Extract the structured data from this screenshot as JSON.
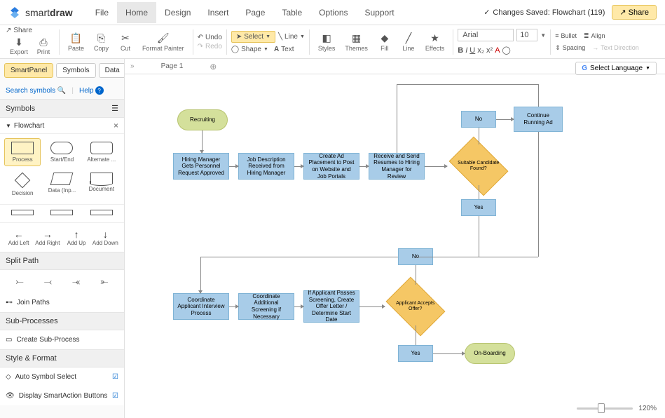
{
  "app": {
    "name_pre": "smart",
    "name_bold": "draw"
  },
  "menu": [
    "File",
    "Home",
    "Design",
    "Insert",
    "Page",
    "Table",
    "Options",
    "Support"
  ],
  "menu_active": 1,
  "status": {
    "saved": "Changes Saved: Flowchart (119)",
    "share": "Share"
  },
  "ribbon": {
    "export": "Export",
    "print": "Print",
    "share": "Share",
    "paste": "Paste",
    "copy": "Copy",
    "cut": "Cut",
    "fmt": "Format Painter",
    "undo": "Undo",
    "redo": "Redo",
    "select": "Select",
    "shape": "Shape",
    "line": "Line",
    "text": "Text",
    "styles": "Styles",
    "themes": "Themes",
    "fill": "Fill",
    "line2": "Line",
    "effects": "Effects",
    "font": "Arial",
    "fontsize": "10",
    "bullet": "Bullet",
    "align": "Align",
    "spacing": "Spacing",
    "textdir": "Text Direction"
  },
  "tabs": [
    "SmartPanel",
    "Symbols",
    "Data"
  ],
  "tabs_active": 0,
  "search": {
    "label": "Search symbols",
    "help": "Help"
  },
  "symbols_hdr": "Symbols",
  "shape_cat": "Flowchart",
  "shapes": [
    "Process",
    "Start/End",
    "Alternate ...",
    "Decision",
    "Data (Inp...",
    "Document"
  ],
  "dirs": [
    "Add Left",
    "Add Right",
    "Add Up",
    "Add Down"
  ],
  "split_hdr": "Split Path",
  "join": "Join Paths",
  "subproc_hdr": "Sub-Processes",
  "subproc_item": "Create Sub-Process",
  "style_hdr": "Style & Format",
  "style_items": [
    "Auto Symbol Select",
    "Display SmartAction Buttons"
  ],
  "page_tab": "Page 1",
  "lang": "Select Language",
  "zoom": "120%",
  "nodes": {
    "recruiting": "Recruiting",
    "n1": "Hiring Manager Gets Personnel Request Approved",
    "n2": "Job Description Received from Hiring Manager",
    "n3": "Create Ad Placement to Post on Website and Job Portals",
    "n4": "Receive and Send Resumes to Hiring Manager for Review",
    "d1": "Suitable Candidate Found?",
    "no1": "No",
    "yes1": "Yes",
    "cont": "Continue Running Ad",
    "n5": "Coordinate Applicant Interview Process",
    "n6": "Coordinate Additional Screening if Necessary",
    "n7": "If Applicant Passes Screening, Create Offer Letter / Determine Start Date",
    "d2": "Applicant Accepts Offer?",
    "no2": "No",
    "yes2": "Yes",
    "onboard": "On-Boarding"
  }
}
